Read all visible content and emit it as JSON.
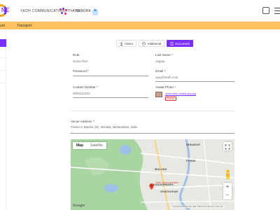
{
  "header": {
    "org_name": "VEDH COMMUNICATION, THANE",
    "location": "BANDRA"
  },
  "breadcrumb": {
    "current": "Transport"
  },
  "tabs": [
    {
      "label": "Visitor",
      "icon": "person-icon",
      "active": false
    },
    {
      "label": "Additional",
      "icon": "clock-icon",
      "active": false
    },
    {
      "label": "Document",
      "icon": "document-icon",
      "active": true
    }
  ],
  "form": {
    "role": {
      "label": "Role",
      "value": "Subscriber"
    },
    "last_name": {
      "label": "Last Name *",
      "value": "Jagtap"
    },
    "password": {
      "label": "Password *",
      "value": ""
    },
    "email": {
      "label": "Email *",
      "value": "ajay@vedh.com"
    },
    "contact": {
      "label": "Contact Number *",
      "value": "9900112233"
    },
    "passport": {
      "label": "Avatar Photo *",
      "file_link": "subscriber-avatar-jpg.jpg",
      "remove": "Delete"
    },
    "address": {
      "label": "Venue Address *",
      "value": "Pocket-3, Bandra (W), Mumbai, Maharashtra, India"
    }
  },
  "map": {
    "map_label": "Map",
    "satellite_label": "Satellite",
    "place_labels": [
      "BHANDUP",
      "MULUND",
      "POWAI",
      "KANJURMARG",
      "GHATKOPAR"
    ],
    "poi_label": "Vedh Communication",
    "footer": "Keyboard shortcuts   Map data ©2024   Terms   Report a map error",
    "brand": "Google",
    "zoom_in": "+",
    "zoom_out": "−"
  },
  "colors": {
    "accent": "#7b2ff7",
    "crumb_bar": "#fbc15e",
    "logo_orange": "#f2a51a"
  }
}
